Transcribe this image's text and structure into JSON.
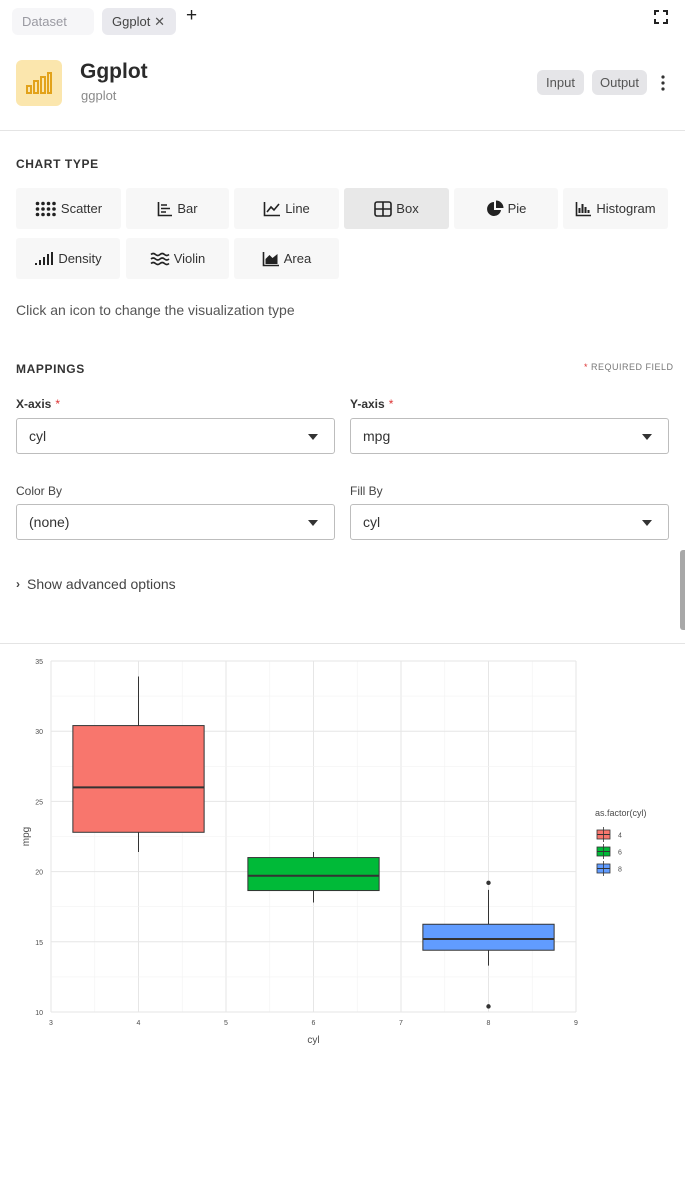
{
  "tabs": [
    {
      "label": "Dataset",
      "active": false
    },
    {
      "label": "Ggplot",
      "active": true,
      "close": "✕"
    }
  ],
  "tab_add": "+",
  "header": {
    "title": "Ggplot",
    "subtitle": "ggplot",
    "input_label": "Input",
    "output_label": "Output",
    "logo_icon": "bar-chart-icon",
    "logo_bg": "#fbe6ad",
    "logo_color": "#e2a21a"
  },
  "chart_type": {
    "label": "CHART TYPE",
    "items": [
      {
        "label": "Scatter",
        "icon": "scatter-icon"
      },
      {
        "label": "Bar",
        "icon": "bar-icon"
      },
      {
        "label": "Line",
        "icon": "line-icon"
      },
      {
        "label": "Box",
        "icon": "box-icon",
        "active": true
      },
      {
        "label": "Pie",
        "icon": "pie-icon"
      },
      {
        "label": "Histogram",
        "icon": "histogram-icon"
      },
      {
        "label": "Density",
        "icon": "density-icon"
      },
      {
        "label": "Violin",
        "icon": "violin-icon"
      },
      {
        "label": "Area",
        "icon": "area-icon"
      }
    ],
    "hint": "Click an icon to change the visualization type"
  },
  "mappings": {
    "label": "MAPPINGS",
    "required_star": "*",
    "required_note": "REQUIRED FIELD",
    "x_axis": {
      "label": "X-axis",
      "value": "cyl",
      "required": "*"
    },
    "y_axis": {
      "label": "Y-axis",
      "value": "mpg",
      "required": "*"
    },
    "color_by": {
      "label": "Color By",
      "value": "(none)"
    },
    "fill_by": {
      "label": "Fill By",
      "value": "cyl"
    }
  },
  "advanced": {
    "chevron": "›",
    "label": "Show advanced options"
  },
  "chart_data": {
    "type": "box",
    "xlabel": "cyl",
    "ylabel": "mpg",
    "xlim": [
      3,
      9
    ],
    "ylim": [
      10,
      35
    ],
    "x_ticks": [
      3,
      4,
      5,
      6,
      7,
      8,
      9
    ],
    "y_ticks": [
      10,
      15,
      20,
      25,
      30,
      35
    ],
    "grid": true,
    "legend": {
      "title": "as.factor(cyl)",
      "placement": "right"
    },
    "series": [
      {
        "name": "4",
        "x": 4,
        "min": 21.4,
        "q1": 22.8,
        "median": 26.0,
        "q3": 30.4,
        "max": 33.9,
        "outliers": [],
        "color": "#f8766d"
      },
      {
        "name": "6",
        "x": 6,
        "min": 17.8,
        "q1": 18.65,
        "median": 19.7,
        "q3": 21.0,
        "max": 21.4,
        "outliers": [],
        "color": "#00ba38"
      },
      {
        "name": "8",
        "x": 8,
        "min": 13.3,
        "q1": 14.4,
        "median": 15.2,
        "q3": 16.25,
        "max": 18.7,
        "outliers": [
          10.4,
          19.2
        ],
        "color": "#619cff"
      }
    ]
  }
}
